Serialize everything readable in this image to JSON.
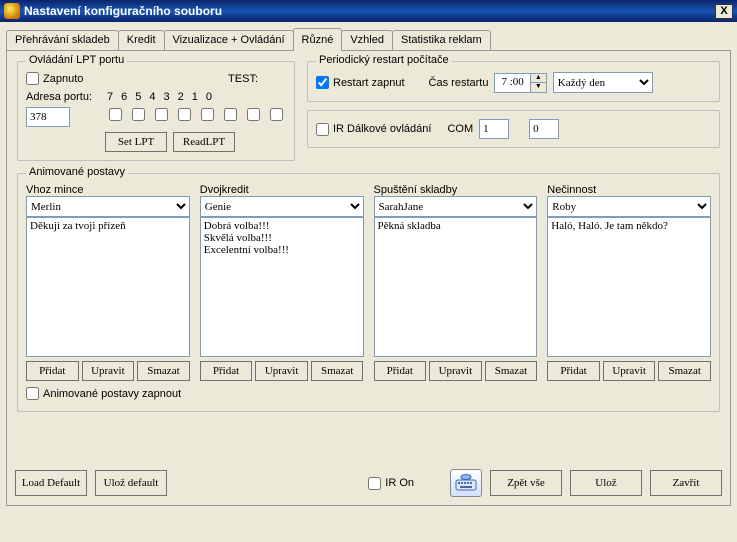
{
  "window": {
    "title": "Nastavení konfiguračního souboru",
    "close": "X"
  },
  "tabs": {
    "t0": "Přehrávání skladeb",
    "t1": "Kredit",
    "t2": "Vizualizace + Ovládání",
    "t3": "Různé",
    "t4": "Vzhled",
    "t5": "Statistika reklam"
  },
  "lpt": {
    "legend": "Ovládání LPT portu",
    "zapnuto": "Zapnuto",
    "test": "TEST:",
    "adresa_label": "Adresa portu:",
    "adresa_value": "378",
    "nums": {
      "n0": "7",
      "n1": "6",
      "n2": "5",
      "n3": "4",
      "n4": "3",
      "n5": "2",
      "n6": "1",
      "n7": "0"
    },
    "set_btn": "Set LPT",
    "read_btn": "ReadLPT"
  },
  "restart": {
    "legend": "Periodický restart počítače",
    "zapnut": "Restart zapnut",
    "cas_label": "Čas restartu",
    "cas_value": "7 :00",
    "freq": "Každý den"
  },
  "ir": {
    "label": "IR Dálkové ovládání",
    "com_label": "COM",
    "com_value": "1",
    "extra_value": "0"
  },
  "anim": {
    "legend": "Animované postavy",
    "enable": "Animované postavy zapnout",
    "cols": {
      "vhoz": {
        "label": "Vhoz mince",
        "sel": "Merlin",
        "text": "Děkuji za tvoji přízeň"
      },
      "dvoj": {
        "label": "Dvojkredit",
        "sel": "Genie",
        "text": "Dobrá volba!!!\nSkvělá volba!!!\nExcelentní volba!!!"
      },
      "spust": {
        "label": "Spuštění skladby",
        "sel": "SarahJane",
        "text": "Pěkná skladba"
      },
      "necin": {
        "label": "Nečinnost",
        "sel": "Roby",
        "text": "Haló, Haló. Je tam někdo?"
      }
    },
    "btn_add": "Přidat",
    "btn_edit": "Upravit",
    "btn_del": "Smazat"
  },
  "bottom": {
    "load_default": "Load Default",
    "uloz_default": "Ulož default",
    "ir_on": "IR On",
    "zpet_vse": "Zpět vše",
    "uloz": "Ulož",
    "zavrit": "Zavřít"
  }
}
